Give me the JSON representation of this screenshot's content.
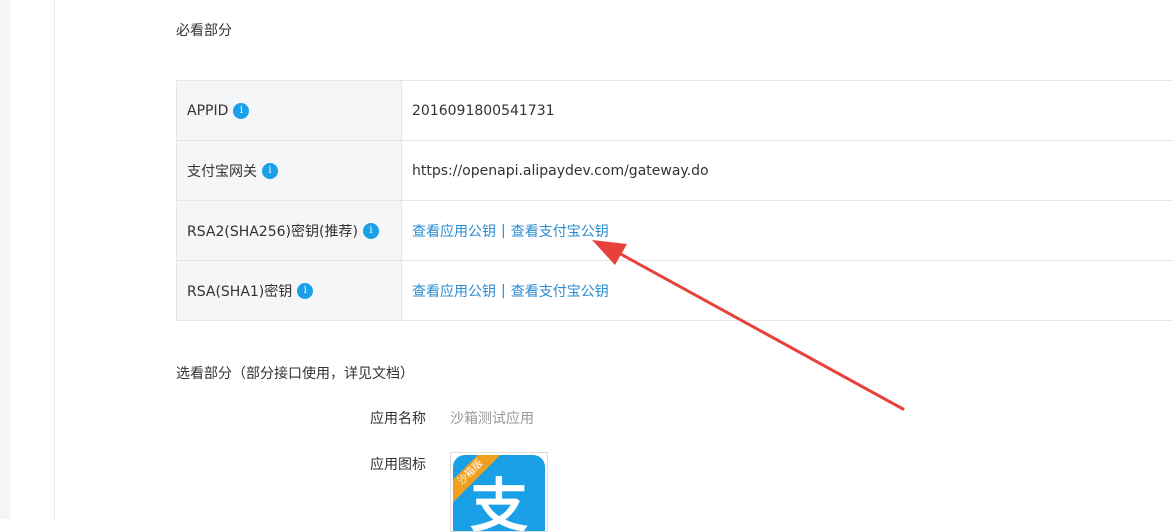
{
  "required_section": {
    "title": "必看部分"
  },
  "key_table": {
    "rows": [
      {
        "label": "APPID",
        "value": "2016091800541731"
      },
      {
        "label": "支付宝网关",
        "value": "https://openapi.alipaydev.com/gateway.do"
      },
      {
        "label": "RSA2(SHA256)密钥(推荐)",
        "link_app": "查看应用公钥",
        "separator": "|",
        "link_alipay": "查看支付宝公钥"
      },
      {
        "label": "RSA(SHA1)密钥",
        "link_app": "查看应用公钥",
        "separator": "|",
        "link_alipay": "查看支付宝公钥"
      }
    ],
    "info_glyph": "i"
  },
  "optional_section": {
    "title": "选看部分（部分接口使用，详见文档）",
    "app_name_label": "应用名称",
    "app_name_value": "沙箱测试应用",
    "app_icon_label": "应用图标",
    "app_icon_char": "支",
    "app_icon_badge": "沙箱版"
  },
  "colors": {
    "link": "#2a8cd1",
    "info_icon": "#1aa0e6",
    "annotation_arrow": "#e8413b"
  }
}
